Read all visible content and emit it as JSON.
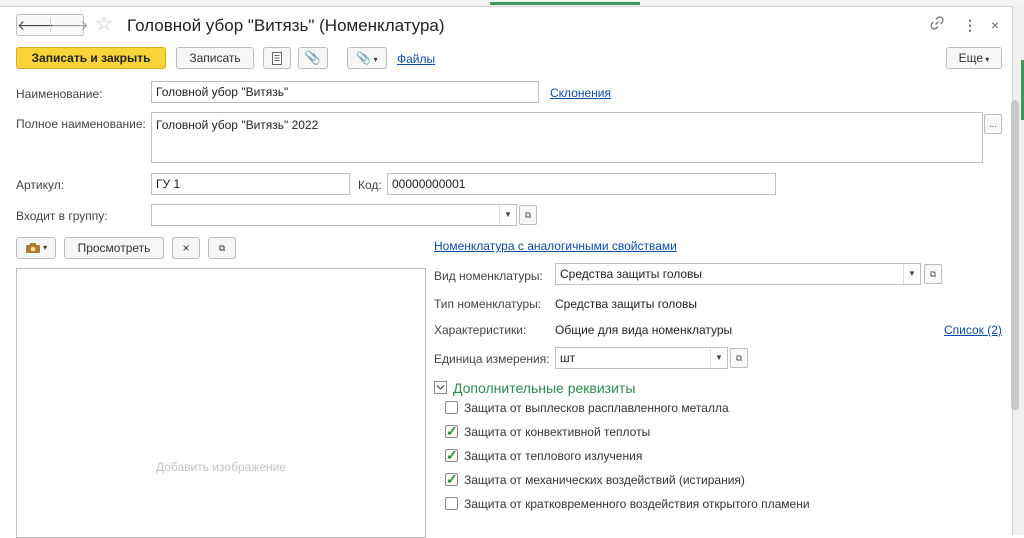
{
  "window": {
    "title": "Головной убор \"Витязь\" (Номенклатура)",
    "back_icon": "arrow-left-icon",
    "forward_icon": "arrow-right-icon",
    "link_icon": "link-icon",
    "menu_icon": "more-vertical-icon",
    "close_icon": "close-icon"
  },
  "toolbar": {
    "save_close_label": "Записать и закрыть",
    "save_label": "Записать",
    "files_label": "Файлы",
    "more_label": "Еще"
  },
  "form": {
    "name_label": "Наименование:",
    "name_value": "Головной убор \"Витязь\"",
    "declension_link": "Склонения",
    "full_name_label": "Полное наименование:",
    "full_name_value": "Головной убор \"Витязь\" 2022",
    "article_label": "Артикул:",
    "article_value": "ГУ 1",
    "code_label": "Код:",
    "code_value": "00000000001",
    "group_label": "Входит в группу:",
    "group_value": ""
  },
  "image_panel": {
    "view_label": "Просмотреть",
    "clear_label": "×",
    "placeholder": "Добавить изображение"
  },
  "properties": {
    "similar_link": "Номенклатура с аналогичными свойствами",
    "kind_label": "Вид номенклатуры:",
    "kind_value": "Средства защиты головы",
    "type_label": "Тип номенклатуры:",
    "type_value": "Средства защиты головы",
    "characteristics_label": "Характеристики:",
    "characteristics_value": "Общие для вида номенклатуры",
    "list_link": "Список (2)",
    "unit_label": "Единица измерения:",
    "unit_value": "шт"
  },
  "extra": {
    "section_title": "Дополнительные реквизиты",
    "items": [
      {
        "label": "Защита от выплесков расплавленного металла",
        "checked": false
      },
      {
        "label": "Защита от конвективной теплоты",
        "checked": true
      },
      {
        "label": "Защита от теплового излучения",
        "checked": true
      },
      {
        "label": "Защита от механических воздействий (истирания)",
        "checked": true
      },
      {
        "label": "Защита от кратковременного воздействия открытого пламени",
        "checked": false
      }
    ]
  },
  "colors": {
    "accent_yellow": "#f8d33a",
    "link_blue": "#0a4ca8",
    "section_green": "#2e8b4e"
  }
}
